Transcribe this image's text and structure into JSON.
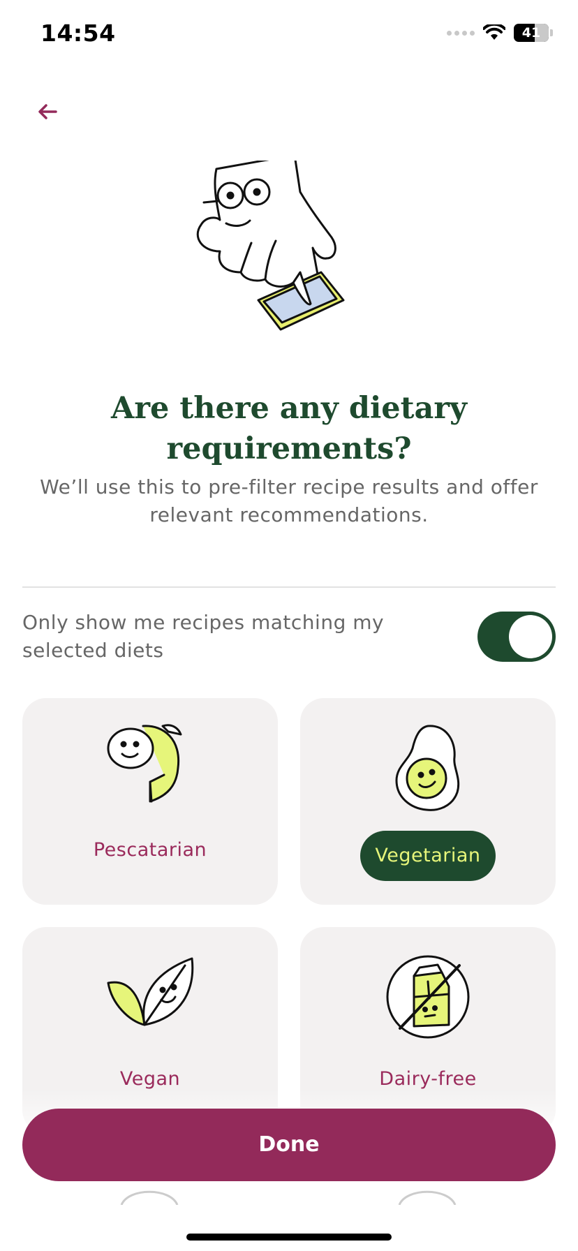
{
  "status_bar": {
    "time": "14:54",
    "battery_percent": "41",
    "icons": [
      "cellular-signal-icon",
      "wifi-icon",
      "battery-icon"
    ]
  },
  "nav": {
    "back_icon": "arrow-left-icon"
  },
  "colors": {
    "brand": "#932a5a",
    "accent_green": "#1e4a2e",
    "highlight_yellow": "#e6f57a",
    "card_bg": "#f3f1f1"
  },
  "header": {
    "title": "Are there any dietary requirements?",
    "subtitle": "We’ll use this to pre-filter recipe results and offer relevant recommendations."
  },
  "filter_toggle": {
    "label": "Only show me recipes matching my selected diets",
    "on": true
  },
  "diets": [
    {
      "label": "Pescatarian",
      "icon": "fish-icon",
      "selected": false
    },
    {
      "label": "Vegetarian",
      "icon": "egg-icon",
      "selected": true
    },
    {
      "label": "Vegan",
      "icon": "leaf-icon",
      "selected": false
    },
    {
      "label": "Dairy-free",
      "icon": "no-dairy-icon",
      "selected": false
    }
  ],
  "footer": {
    "done_label": "Done"
  }
}
